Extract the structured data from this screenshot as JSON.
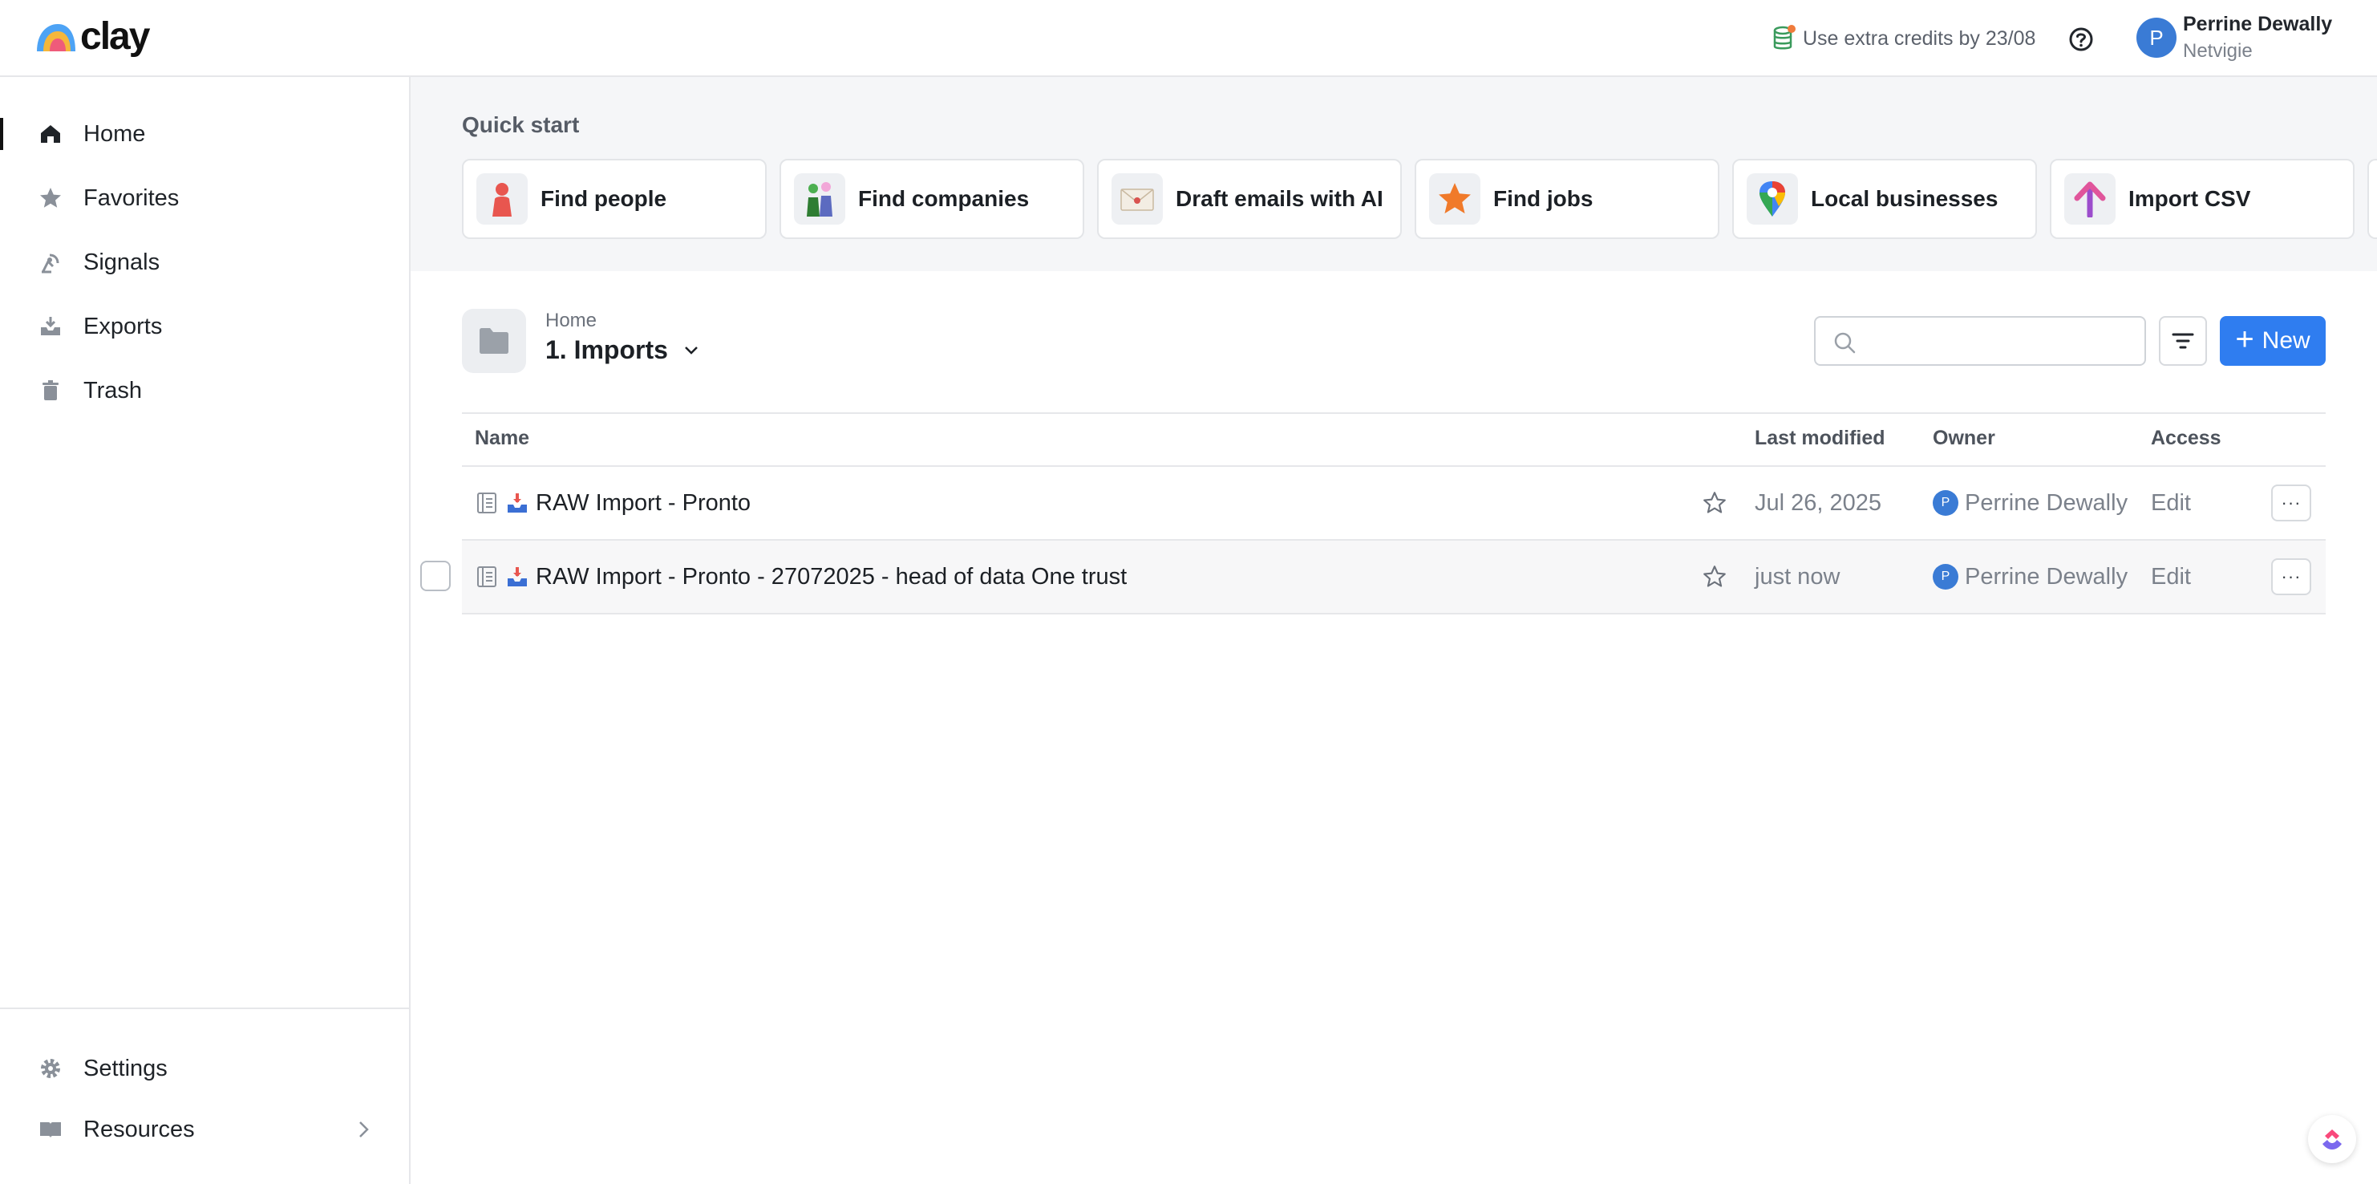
{
  "app": {
    "logo_text": "clay"
  },
  "topbar": {
    "credits_text": "Use extra credits by 23/08",
    "user_initial": "P",
    "user_name": "Perrine Dewally",
    "user_org": "Netvigie"
  },
  "sidebar": {
    "items": [
      {
        "label": "Home",
        "icon": "home-icon",
        "active": true
      },
      {
        "label": "Favorites",
        "icon": "star-icon"
      },
      {
        "label": "Signals",
        "icon": "signal-icon"
      },
      {
        "label": "Exports",
        "icon": "export-icon"
      },
      {
        "label": "Trash",
        "icon": "trash-icon"
      }
    ],
    "bottom": [
      {
        "label": "Settings",
        "icon": "gear-icon"
      },
      {
        "label": "Resources",
        "icon": "book-icon"
      }
    ]
  },
  "quickstart": {
    "title": "Quick start",
    "cards": [
      {
        "label": "Find people",
        "icon": "person-icon"
      },
      {
        "label": "Find companies",
        "icon": "company-people-icon"
      },
      {
        "label": "Draft emails with AI",
        "icon": "envelope-icon"
      },
      {
        "label": "Find jobs",
        "icon": "star-icon"
      },
      {
        "label": "Local businesses",
        "icon": "map-pin-icon"
      },
      {
        "label": "Import CSV",
        "icon": "upload-arrow-icon"
      }
    ]
  },
  "folder": {
    "breadcrumb": "Home",
    "title": "1. Imports",
    "search_placeholder": "",
    "new_label": "New"
  },
  "table": {
    "headers": {
      "name": "Name",
      "modified": "Last modified",
      "owner": "Owner",
      "access": "Access"
    },
    "rows": [
      {
        "name": "RAW Import - Pronto",
        "modified": "Jul 26, 2025",
        "owner_initial": "P",
        "owner": "Perrine Dewally",
        "access": "Edit",
        "more": "···"
      },
      {
        "name": "RAW Import - Pronto - 27072025 - head of data One trust",
        "modified": "just now",
        "owner_initial": "P",
        "owner": "Perrine Dewally",
        "access": "Edit",
        "more": "···"
      }
    ]
  },
  "colors": {
    "accent": "#2f7df0",
    "avatar": "#3a7bd5",
    "quickstart_bg": "#f5f6f8"
  }
}
